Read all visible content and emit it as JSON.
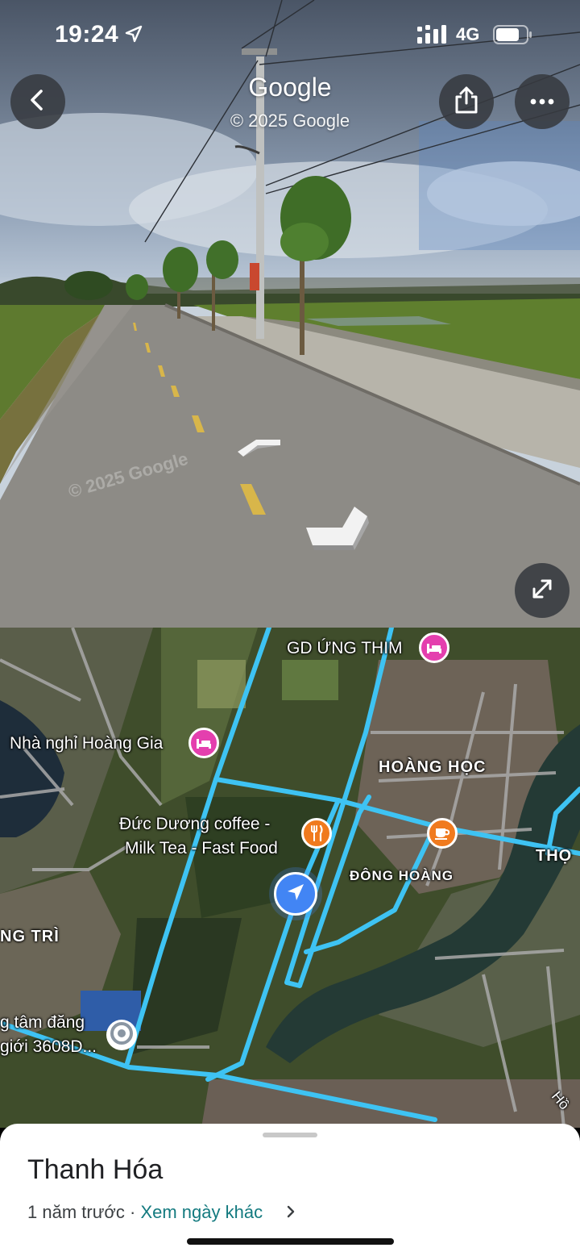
{
  "status_bar": {
    "time": "19:24",
    "network": "4G"
  },
  "street_view": {
    "brand": "Google",
    "copyright": "© 2025 Google",
    "watermark": "© 2025 Google",
    "icons": {
      "back": "back-arrow-icon",
      "share": "share-icon",
      "more": "more-horizontal-icon",
      "expand": "expand-icon",
      "nav_forward": "chevron-forward-icon",
      "nav_back": "chevron-back-icon"
    }
  },
  "map": {
    "route_color": "#3ec3f3",
    "labels": {
      "gd_ung_thim": "GD ỨNG THIM",
      "nha_nghi": "Nhà nghỉ Hoàng Gia",
      "hoang_hoc": "HOÀNG HỌC",
      "coffee_line1": "Đức Dương coffee -",
      "coffee_line2": "Milk Tea - Fast Food",
      "tho": "THỌ",
      "dong_hoang": "ĐÔNG HOÀNG",
      "ng_tri": "NG TRÌ",
      "tam_dang_line1": "g tâm đăng",
      "tam_dang_line2": "giới 3608D...",
      "ho": "Hồ"
    }
  },
  "sheet": {
    "title": "Thanh Hóa",
    "time_ago": "1 năm trước",
    "separator": "·",
    "link": "Xem ngày khác"
  }
}
